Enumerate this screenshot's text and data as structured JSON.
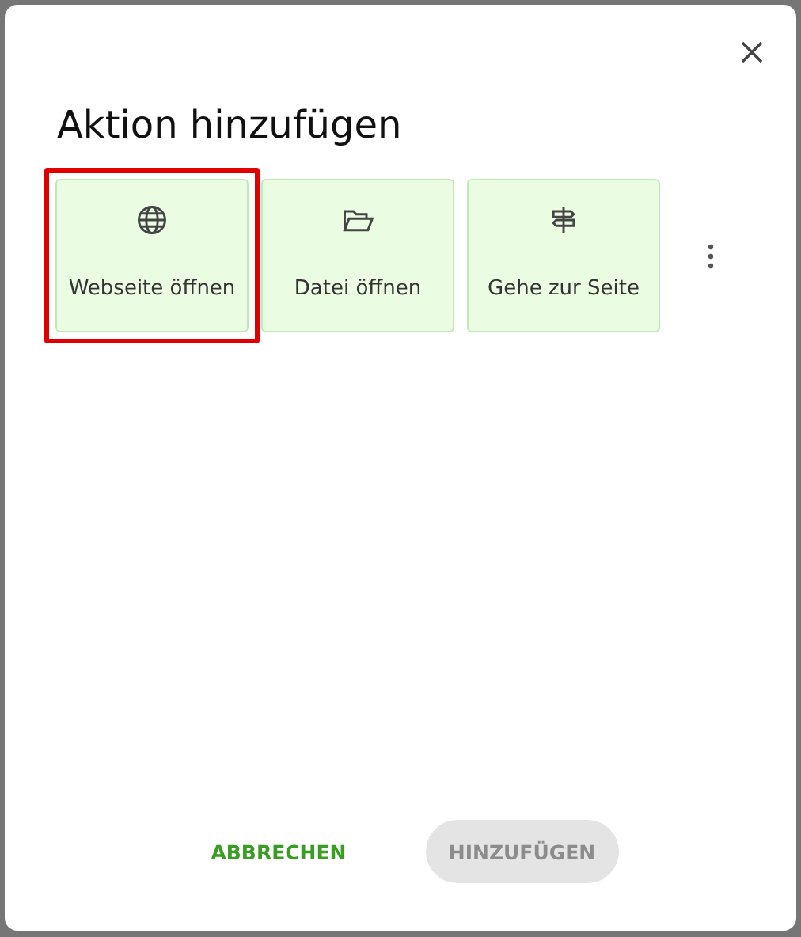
{
  "dialog": {
    "title": "Aktion hinzufügen"
  },
  "actions": [
    {
      "label": "Webseite öffnen",
      "kind": "globe",
      "selected": true
    },
    {
      "label": "Datei öffnen",
      "kind": "folder",
      "selected": false
    },
    {
      "label": "Gehe zur Seite",
      "kind": "signpost",
      "selected": false
    }
  ],
  "buttons": {
    "cancel": {
      "label": "ABBRECHEN"
    },
    "add": {
      "label": "HINZUFÜGEN",
      "disabled": true
    }
  }
}
